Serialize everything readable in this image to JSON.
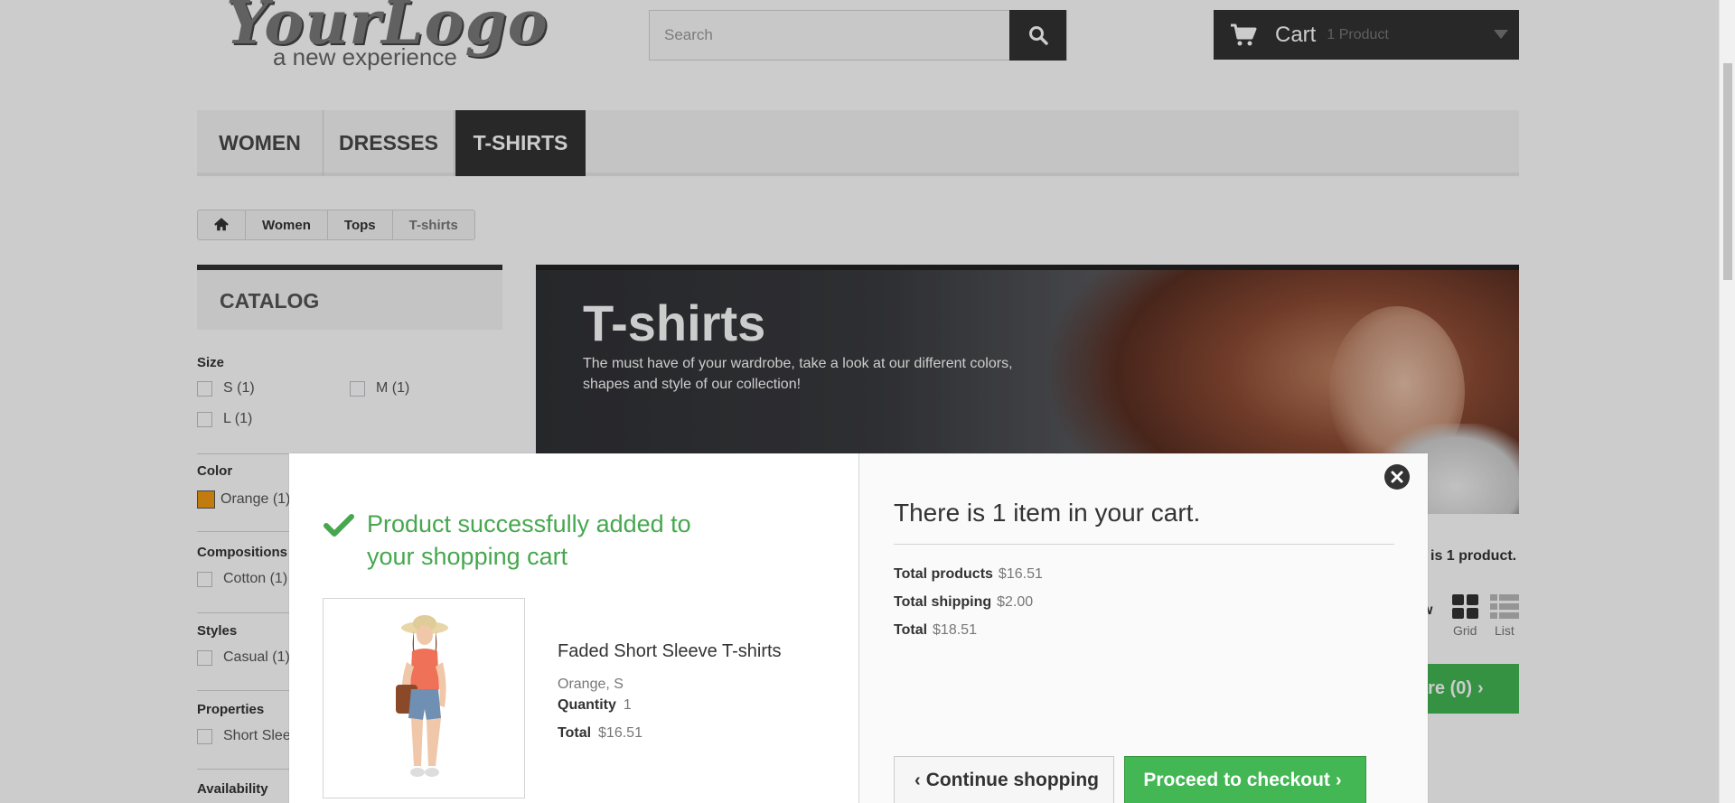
{
  "header": {
    "logo_main": "YourLogo",
    "logo_sub": "a new experience",
    "search_placeholder": "Search",
    "cart_label": "Cart",
    "cart_qty": "1 Product"
  },
  "menu": {
    "items": [
      {
        "label": "WOMEN"
      },
      {
        "label": "DRESSES"
      },
      {
        "label": "T-SHIRTS"
      }
    ],
    "active": "T-SHIRTS"
  },
  "breadcrumb": {
    "items": [
      "Women",
      "Tops",
      "T-shirts"
    ]
  },
  "sidebar": {
    "catalog_title": "CATALOG",
    "size_label": "Size",
    "size_options": [
      "S (1)",
      "M (1)",
      "L (1)"
    ],
    "color_label": "Color",
    "color_option": "Orange (1)",
    "color_swatch": "#f39c11",
    "compositions_label": "Compositions",
    "composition_option": "Cotton (1)",
    "styles_label": "Styles",
    "style_option": "Casual (1)",
    "properties_label": "Properties",
    "property_option": "Short Slee",
    "availability_label": "Availability"
  },
  "banner": {
    "title": "T-shirts",
    "description": "The must have of your wardrobe, take a look at our different colors, shapes and style of our collection!"
  },
  "listing": {
    "product_count_text": "is 1 product.",
    "view_partial": "w",
    "grid_label": "Grid",
    "list_label": "List",
    "compare_label": "are (0)"
  },
  "modal": {
    "success_title": "Product successfully added to your shopping cart",
    "product_name": "Faded Short Sleeve T-shirts",
    "product_attributes": "Orange, S",
    "quantity_label": "Quantity",
    "quantity_value": "1",
    "total_label": "Total",
    "total_value": "$16.51",
    "cart_count_title": "There is 1 item in your cart.",
    "total_products_label": "Total products",
    "total_products_value": "$16.51",
    "total_shipping_label": "Total shipping",
    "total_shipping_value": "$2.00",
    "grand_total_label": "Total",
    "grand_total_value": "$18.51",
    "continue_label": "Continue shopping",
    "checkout_label": "Proceed to checkout"
  },
  "colors": {
    "accent_green": "#46a74e",
    "button_green": "#43b754",
    "dark": "#333333"
  }
}
